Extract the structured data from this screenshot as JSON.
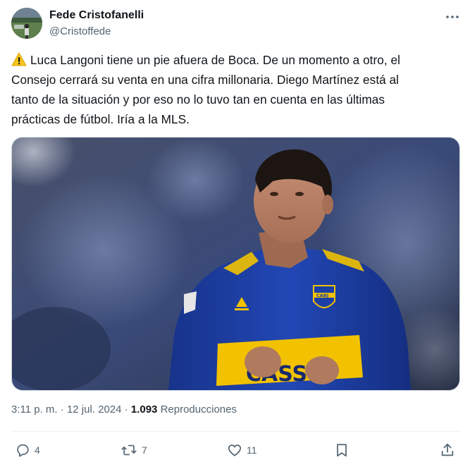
{
  "author": {
    "name": "Fede Cristofanelli",
    "handle": "@Cristoffede"
  },
  "tweet": {
    "lines": [
      "Luca Langoni tiene un pie afuera de Boca. De un momento a otro, el",
      "Consejo cerrará su venta en una cifra millonaria. Diego Martínez está al",
      "tanto de la situación y por eso no lo tuvo tan en cuenta en las últimas",
      "prácticas de fútbol. Iría a la MLS."
    ],
    "lead_icon": "warning-icon",
    "media": {
      "subject": "Boca Juniors player in blue and gold jersey",
      "jersey_text": "CASSO",
      "crest_text": "CABJ"
    }
  },
  "meta": {
    "time": "3:11 p. m.",
    "separator": "·",
    "date": "12 jul. 2024",
    "views_count": "1.093",
    "views_label": "Reproducciones"
  },
  "actions": {
    "reply_count": "4",
    "retweet_count": "7",
    "like_count": "11"
  },
  "colors": {
    "text": "#0f1419",
    "secondary": "#536471",
    "divider": "#eff3f4",
    "jersey_blue": "#1a3fa6",
    "jersey_gold": "#f2c200"
  }
}
